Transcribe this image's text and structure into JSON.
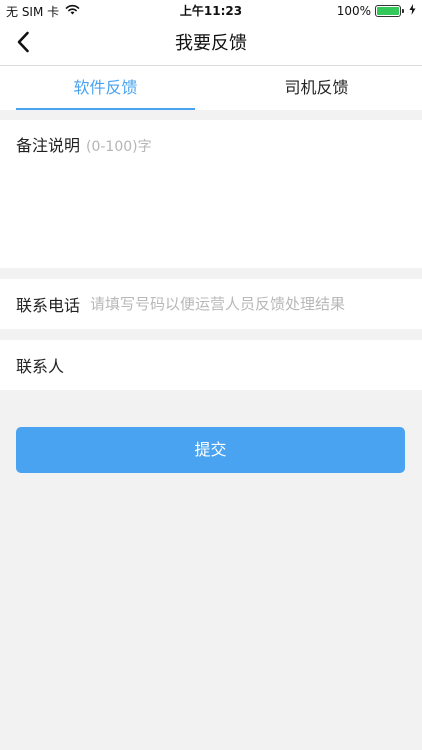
{
  "status_bar": {
    "carrier": "无 SIM 卡",
    "time": "上午11:23",
    "battery_percent": "100%",
    "battery_level": 1.0,
    "battery_color": "#34c759"
  },
  "nav": {
    "title": "我要反馈",
    "back_icon": "chevron-left-icon"
  },
  "tabs": [
    {
      "label": "软件反馈",
      "active": true
    },
    {
      "label": "司机反馈",
      "active": false
    }
  ],
  "note": {
    "label": "备注说明",
    "hint": "(0-100)字",
    "value": ""
  },
  "phone": {
    "label": "联系电话",
    "placeholder": "请填写号码以便运营人员反馈处理结果",
    "value": ""
  },
  "contact": {
    "label": "联系人",
    "placeholder": "",
    "value": ""
  },
  "submit": {
    "label": "提交"
  },
  "colors": {
    "accent": "#4aa3f0",
    "background": "#f2f2f2",
    "placeholder": "#b8b8b8"
  }
}
